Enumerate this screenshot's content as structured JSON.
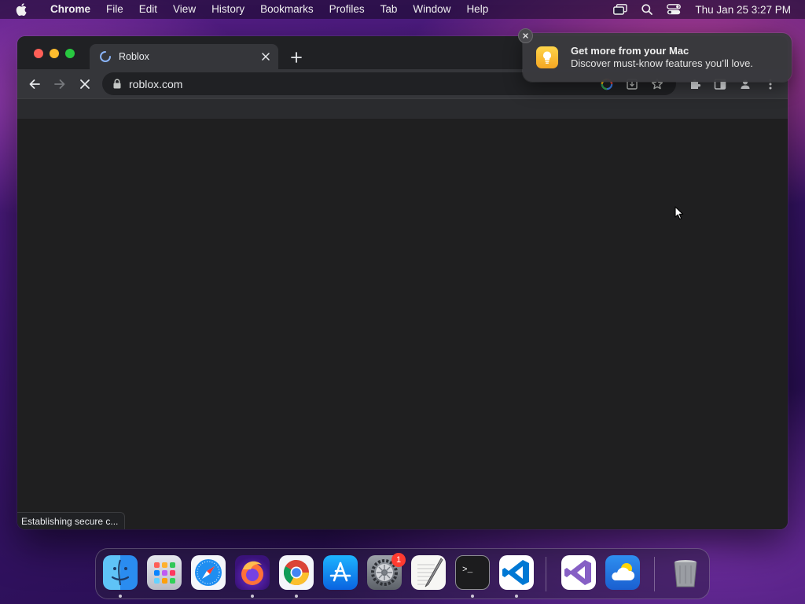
{
  "menubar": {
    "app_name": "Chrome",
    "items": [
      "File",
      "Edit",
      "View",
      "History",
      "Bookmarks",
      "Profiles",
      "Tab",
      "Window",
      "Help"
    ],
    "clock": "Thu Jan 25  3:27 PM",
    "status_icons": [
      "screen-mirroring-icon",
      "spotlight-search-icon",
      "control-center-icon"
    ]
  },
  "browser": {
    "tab": {
      "title": "Roblox",
      "loading": true
    },
    "omnibox": {
      "url": "roblox.com"
    },
    "status_text": "Establishing secure c..."
  },
  "notification": {
    "title": "Get more from your Mac",
    "body": "Discover must-know features you’ll love."
  },
  "dock": {
    "apps": [
      "Finder",
      "Launchpad",
      "Safari",
      "Firefox",
      "Google Chrome",
      "App Store",
      "System Settings",
      "TextEdit",
      "Terminal",
      "Visual Studio Code",
      "Visual Studio",
      "Weather",
      "Trash"
    ],
    "running": [
      "Finder",
      "Firefox",
      "Google Chrome",
      "Terminal",
      "Visual Studio Code"
    ],
    "system_settings_badge": "1"
  },
  "colors": {
    "tab_spinner": "#8ab4f8",
    "close_red": "#ff5f57",
    "minimize_yellow": "#febc2e",
    "zoom_green": "#28c840",
    "badge_red": "#ff3b30"
  }
}
